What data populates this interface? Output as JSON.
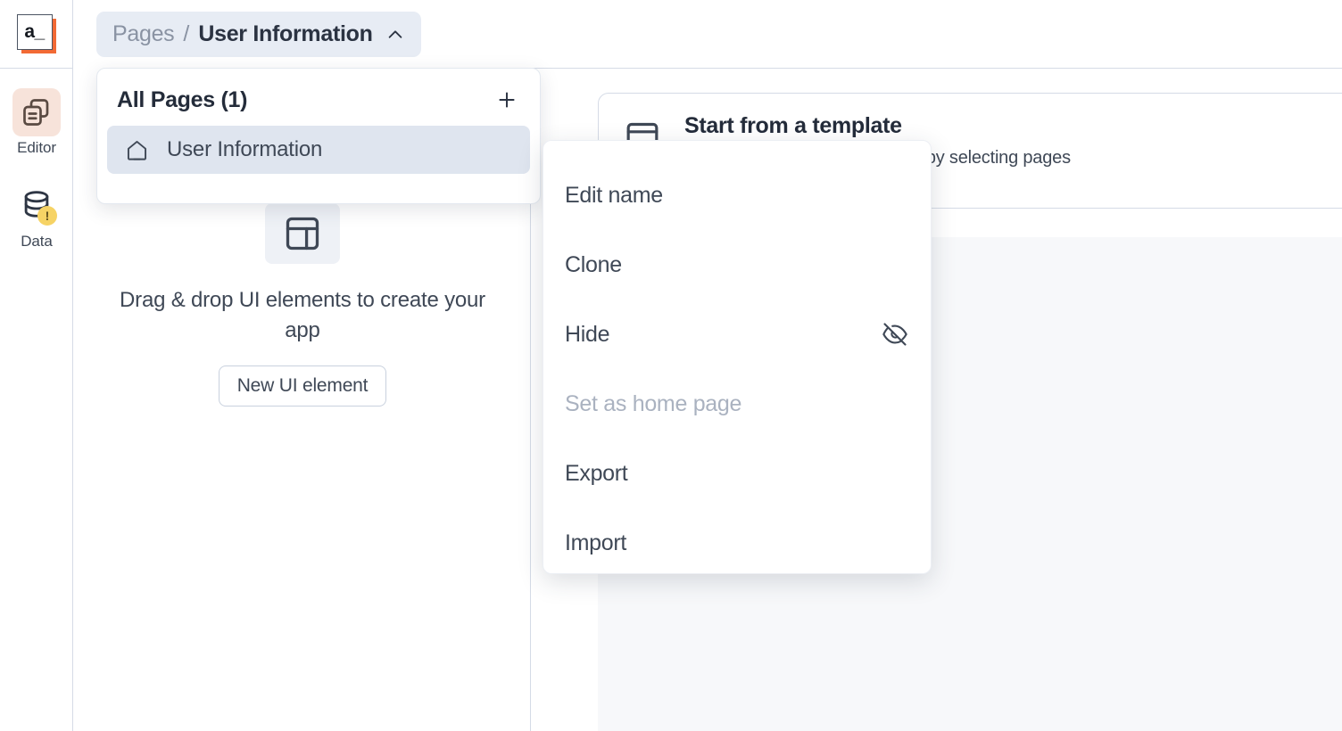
{
  "brand": {
    "logo_text": "a_",
    "accent_color": "#f26a35"
  },
  "rail": {
    "items": [
      {
        "label": "Editor",
        "icon": "copy-pages-icon",
        "active": true,
        "badge": null
      },
      {
        "label": "Data",
        "icon": "database-icon",
        "active": false,
        "badge": "!"
      }
    ]
  },
  "breadcrumb": {
    "root_label": "Pages",
    "separator": "/",
    "current_label": "User Information",
    "chevron": "chevron-up-icon"
  },
  "pages_panel": {
    "title": "All Pages (1)",
    "add_label": "+",
    "items": [
      {
        "label": "User Information",
        "icon": "home-icon",
        "selected": true
      }
    ]
  },
  "context_menu": {
    "items": [
      {
        "label": "Edit name",
        "disabled": false,
        "icon": null
      },
      {
        "label": "Clone",
        "disabled": false,
        "icon": null
      },
      {
        "label": "Hide",
        "disabled": false,
        "icon": "eye-off-icon"
      },
      {
        "label": "Set as home page",
        "disabled": true,
        "icon": null
      },
      {
        "label": "Export",
        "disabled": false,
        "icon": null
      },
      {
        "label": "Import",
        "disabled": false,
        "icon": null
      }
    ]
  },
  "canvas": {
    "empty_icon": "layout-icon",
    "empty_text": "Drag & drop UI elements to create your app",
    "new_element_label": "New UI element"
  },
  "template_card": {
    "icon": "template-icon",
    "title": "Start from a template",
    "subtitle": "Create an app from a template by selecting pages"
  },
  "colors": {
    "selected_row": "#dfe5ef",
    "breadcrumb_pill": "#e7ecf4",
    "editor_active": "#f7e3da",
    "warning_badge": "#f6d365",
    "canvas_bg": "#f7f8fa",
    "border": "#d5dbe6"
  }
}
